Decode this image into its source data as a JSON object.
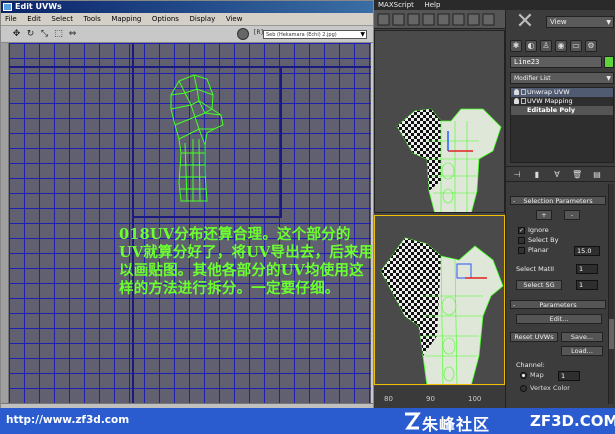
{
  "uv_window": {
    "title": "Edit UVWs",
    "menu": [
      "File",
      "Edit",
      "Select",
      "Tools",
      "Mapping",
      "Options",
      "Display",
      "View"
    ],
    "checker_label": "[R]",
    "texture_dropdown": "Seb (Hekamara (Echi) 2.jpg)",
    "note": "018UV分布还算合理。这个部分的UV就算分好了，将UV导出去，后来用以画贴图。其他各部分的UV均使用这样的方法进行拆分。一定要仔细。"
  },
  "max": {
    "menu": [
      "MAXScript",
      "Help"
    ],
    "view_dropdown": "View",
    "object_name": "Line23",
    "modifier_list": "Modifier List",
    "stack": [
      "Unwrap UVW",
      "UVW Mapping",
      "Editable Poly"
    ],
    "selection_rollout": {
      "title": "Selection Parameters",
      "plus": "+",
      "minus": "-",
      "ignore": "Ignore",
      "select_by": "Select By",
      "planar": "Planar",
      "planar_value": "15.0",
      "select_matid": "Select MatII",
      "select_matid_value": "1",
      "select_sg": "Select SG",
      "select_sg_value": "1"
    },
    "parameters_rollout": {
      "title": "Parameters",
      "edit": "Edit...",
      "reset_uvws": "Reset UVWs",
      "save": "Save...",
      "load": "Load...",
      "channel_label": "Channel:",
      "map": "Map",
      "map_value": "1",
      "vertex_color": "Vertex Color"
    },
    "ruler_ticks": [
      "80",
      "90",
      "100"
    ]
  },
  "banner": {
    "url": "http://www.zf3d.com",
    "name_cn": "朱峰社区",
    "domain": "ZF3D.COM"
  },
  "colors": {
    "uv_grid": "#2020b0",
    "uv_bg": "#606070",
    "note_text": "#6cff2e",
    "uv_wire": "#44ff22",
    "banner": "#2a5cd0"
  }
}
